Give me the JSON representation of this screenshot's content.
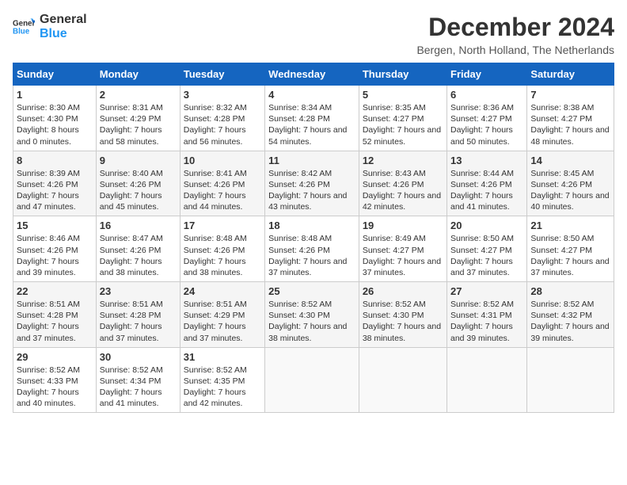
{
  "logo": {
    "line1": "General",
    "line2": "Blue"
  },
  "title": "December 2024",
  "location": "Bergen, North Holland, The Netherlands",
  "days_of_week": [
    "Sunday",
    "Monday",
    "Tuesday",
    "Wednesday",
    "Thursday",
    "Friday",
    "Saturday"
  ],
  "weeks": [
    [
      {
        "day": "1",
        "sunrise": "8:30 AM",
        "sunset": "4:30 PM",
        "daylight": "8 hours and 0 minutes."
      },
      {
        "day": "2",
        "sunrise": "8:31 AM",
        "sunset": "4:29 PM",
        "daylight": "7 hours and 58 minutes."
      },
      {
        "day": "3",
        "sunrise": "8:32 AM",
        "sunset": "4:28 PM",
        "daylight": "7 hours and 56 minutes."
      },
      {
        "day": "4",
        "sunrise": "8:34 AM",
        "sunset": "4:28 PM",
        "daylight": "7 hours and 54 minutes."
      },
      {
        "day": "5",
        "sunrise": "8:35 AM",
        "sunset": "4:27 PM",
        "daylight": "7 hours and 52 minutes."
      },
      {
        "day": "6",
        "sunrise": "8:36 AM",
        "sunset": "4:27 PM",
        "daylight": "7 hours and 50 minutes."
      },
      {
        "day": "7",
        "sunrise": "8:38 AM",
        "sunset": "4:27 PM",
        "daylight": "7 hours and 48 minutes."
      }
    ],
    [
      {
        "day": "8",
        "sunrise": "8:39 AM",
        "sunset": "4:26 PM",
        "daylight": "7 hours and 47 minutes."
      },
      {
        "day": "9",
        "sunrise": "8:40 AM",
        "sunset": "4:26 PM",
        "daylight": "7 hours and 45 minutes."
      },
      {
        "day": "10",
        "sunrise": "8:41 AM",
        "sunset": "4:26 PM",
        "daylight": "7 hours and 44 minutes."
      },
      {
        "day": "11",
        "sunrise": "8:42 AM",
        "sunset": "4:26 PM",
        "daylight": "7 hours and 43 minutes."
      },
      {
        "day": "12",
        "sunrise": "8:43 AM",
        "sunset": "4:26 PM",
        "daylight": "7 hours and 42 minutes."
      },
      {
        "day": "13",
        "sunrise": "8:44 AM",
        "sunset": "4:26 PM",
        "daylight": "7 hours and 41 minutes."
      },
      {
        "day": "14",
        "sunrise": "8:45 AM",
        "sunset": "4:26 PM",
        "daylight": "7 hours and 40 minutes."
      }
    ],
    [
      {
        "day": "15",
        "sunrise": "8:46 AM",
        "sunset": "4:26 PM",
        "daylight": "7 hours and 39 minutes."
      },
      {
        "day": "16",
        "sunrise": "8:47 AM",
        "sunset": "4:26 PM",
        "daylight": "7 hours and 38 minutes."
      },
      {
        "day": "17",
        "sunrise": "8:48 AM",
        "sunset": "4:26 PM",
        "daylight": "7 hours and 38 minutes."
      },
      {
        "day": "18",
        "sunrise": "8:48 AM",
        "sunset": "4:26 PM",
        "daylight": "7 hours and 37 minutes."
      },
      {
        "day": "19",
        "sunrise": "8:49 AM",
        "sunset": "4:27 PM",
        "daylight": "7 hours and 37 minutes."
      },
      {
        "day": "20",
        "sunrise": "8:50 AM",
        "sunset": "4:27 PM",
        "daylight": "7 hours and 37 minutes."
      },
      {
        "day": "21",
        "sunrise": "8:50 AM",
        "sunset": "4:27 PM",
        "daylight": "7 hours and 37 minutes."
      }
    ],
    [
      {
        "day": "22",
        "sunrise": "8:51 AM",
        "sunset": "4:28 PM",
        "daylight": "7 hours and 37 minutes."
      },
      {
        "day": "23",
        "sunrise": "8:51 AM",
        "sunset": "4:28 PM",
        "daylight": "7 hours and 37 minutes."
      },
      {
        "day": "24",
        "sunrise": "8:51 AM",
        "sunset": "4:29 PM",
        "daylight": "7 hours and 37 minutes."
      },
      {
        "day": "25",
        "sunrise": "8:52 AM",
        "sunset": "4:30 PM",
        "daylight": "7 hours and 38 minutes."
      },
      {
        "day": "26",
        "sunrise": "8:52 AM",
        "sunset": "4:30 PM",
        "daylight": "7 hours and 38 minutes."
      },
      {
        "day": "27",
        "sunrise": "8:52 AM",
        "sunset": "4:31 PM",
        "daylight": "7 hours and 39 minutes."
      },
      {
        "day": "28",
        "sunrise": "8:52 AM",
        "sunset": "4:32 PM",
        "daylight": "7 hours and 39 minutes."
      }
    ],
    [
      {
        "day": "29",
        "sunrise": "8:52 AM",
        "sunset": "4:33 PM",
        "daylight": "7 hours and 40 minutes."
      },
      {
        "day": "30",
        "sunrise": "8:52 AM",
        "sunset": "4:34 PM",
        "daylight": "7 hours and 41 minutes."
      },
      {
        "day": "31",
        "sunrise": "8:52 AM",
        "sunset": "4:35 PM",
        "daylight": "7 hours and 42 minutes."
      },
      null,
      null,
      null,
      null
    ]
  ],
  "labels": {
    "sunrise": "Sunrise:",
    "sunset": "Sunset:",
    "daylight": "Daylight:"
  }
}
